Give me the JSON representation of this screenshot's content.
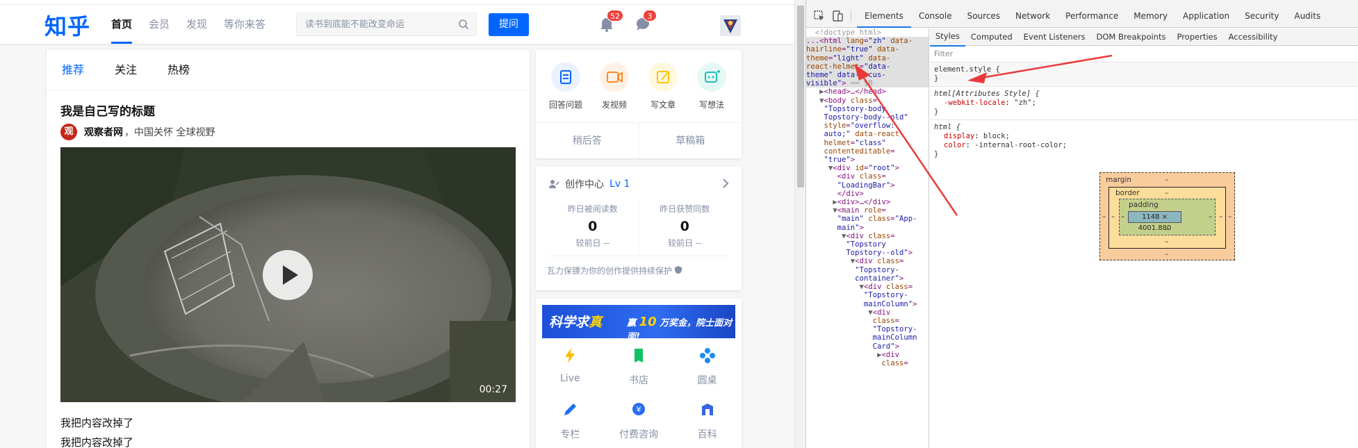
{
  "header": {
    "logo": "知乎",
    "nav": [
      "首页",
      "会员",
      "发现",
      "等你来答"
    ],
    "search_placeholder": "读书到底能不能改变命运",
    "ask_label": "提问",
    "notifications_count": "52",
    "messages_count": "3"
  },
  "feed": {
    "tabs": [
      "推荐",
      "关注",
      "热榜"
    ],
    "item": {
      "title": "我是自己写的标题",
      "author_logo": "观",
      "author_name": "观察者网",
      "author_bio": "，中国关怀 全球视野",
      "video_duration": "00:27",
      "excerpt": [
        "我把内容改掉了",
        "我把内容改掉了"
      ]
    }
  },
  "sidebar": {
    "quick_actions": [
      {
        "label": "回答问题",
        "icon": "answer-icon",
        "color": "#0066ff"
      },
      {
        "label": "发视频",
        "icon": "video-icon",
        "color": "#ff8a1f"
      },
      {
        "label": "写文章",
        "icon": "write-icon",
        "color": "#ffc400"
      },
      {
        "label": "写想法",
        "icon": "idea-icon",
        "color": "#1ebdb3"
      }
    ],
    "quick_bottom": [
      "稍后答",
      "草稿箱"
    ],
    "creator": {
      "title": "创作中心",
      "level": "Lv 1",
      "stats": [
        {
          "label": "昨日被阅读数",
          "value": "0",
          "sub": "较前日 --"
        },
        {
          "label": "昨日获赞同数",
          "value": "0",
          "sub": "较前日 --"
        }
      ],
      "footer": "瓦力保镖为你的创作提供持续保护"
    },
    "banner": {
      "part1": "科学求",
      "part1_em": "真",
      "part2": "赢",
      "part2_em": "10",
      "part3": "万奖金，院士面对面!"
    },
    "apps": [
      {
        "label": "Live",
        "icon": "live-icon",
        "color": "#ffbc00"
      },
      {
        "label": "书店",
        "icon": "bookstore-icon",
        "color": "#12c063"
      },
      {
        "label": "圆桌",
        "icon": "roundtable-icon",
        "color": "#1d8cf0"
      },
      {
        "label": "专栏",
        "icon": "column-icon",
        "color": "#1d6ff0"
      },
      {
        "label": "付费咨询",
        "icon": "paid-consult-icon",
        "color": "#2a6df0"
      },
      {
        "label": "百科",
        "icon": "encyclopedia-icon",
        "color": "#3566e0"
      }
    ]
  },
  "devtools": {
    "tabs": [
      "Elements",
      "Console",
      "Sources",
      "Network",
      "Performance",
      "Memory",
      "Application",
      "Security",
      "Audits"
    ],
    "active_tab": "Elements",
    "sub_tabs": [
      "Styles",
      "Computed",
      "Event Listeners",
      "DOM Breakpoints",
      "Properties",
      "Accessibility"
    ],
    "active_sub_tab": "Styles",
    "filter_placeholder": "Filter",
    "styles": {
      "rule1_selector": "element.style {",
      "rule2_selector": "html[Attributes Style] {",
      "rule2_prop": "-webkit-locale",
      "rule2_val": "\"zh\";",
      "rule3_selector": "html {",
      "rule3_prop1": "display",
      "rule3_val1": "block;",
      "rule3_prop2": "color",
      "rule3_val2": "-internal-root-color;"
    },
    "box_model": {
      "margin": "margin",
      "border": "border",
      "padding": "padding",
      "content": "1148 × 4001.880",
      "dash": "–"
    }
  }
}
